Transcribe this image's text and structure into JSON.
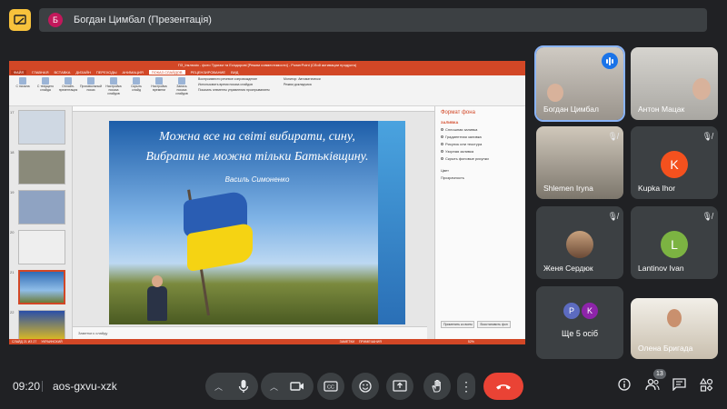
{
  "top": {
    "presenter_initial": "Б",
    "presenter_title": "Богдан Цимбал (Презентація)"
  },
  "share": {
    "ppt_title": "ПЗ_Інклюзія - фото Туризм та Есіздорові [Режим совместимости] - PowerPoint (Сбой активации продукта)",
    "tabs": [
      "ФАЙЛ",
      "ГЛАВНАЯ",
      "ВСТАВКА",
      "ДИЗАЙН",
      "ПЕРЕХОДЫ",
      "АНИМАЦИЯ",
      "ПОКАЗ СЛАЙДОВ",
      "РЕЦЕНЗИРОВАНИЕ",
      "ВИД"
    ],
    "active_tab_index": 6,
    "ribbon_buttons": [
      "С начала",
      "С текущего слайда",
      "Онлайн-презентация",
      "Произвольный показ",
      "Настройка показа слайдов",
      "Скрыть слайд",
      "Настройка времени",
      "Запись показа слайдов"
    ],
    "ribbon_checks": [
      "Воспроизвести речевое сопровождение",
      "Использовать время показа слайдов",
      "Показать элементы управления проигрыванием"
    ],
    "ribbon_monitor": [
      "Монитор: Автоматически",
      "Режим докладчика"
    ],
    "slide_numbers": [
      "17",
      "18",
      "19",
      "20",
      "21",
      "22"
    ],
    "selected_slide_index": 4,
    "slide_line1": "Можна все на світі вибирати, сину,",
    "slide_line2": "Вибрати не можна тільки Батьківщину.",
    "slide_author": "Василь Симоненко",
    "notes": "Заметки к слайду",
    "format_pane_title": "Формат фона",
    "format_pane_section": "ЗАЛИВКА",
    "format_pane_options": [
      "Сплошная заливка",
      "Градиентная заливка",
      "Рисунок или текстура",
      "Узорная заливка",
      "Скрыть фоновые рисунки",
      "Цвет",
      "Прозрачность"
    ],
    "format_pane_buttons": [
      "Применить ко всем",
      "Восстановить фон"
    ],
    "status": [
      "СЛАЙД 21 ИЗ 27",
      "УКРАИНСКИЙ",
      "ЗАМЕТКИ",
      "ПРИМЕЧАНИЯ",
      "52%"
    ]
  },
  "participants": [
    {
      "name": "Богдан Цимбал",
      "type": "video",
      "speaking": true
    },
    {
      "name": "Антон Мацак",
      "type": "video",
      "muted": false
    },
    {
      "name": "Shlemen Iryna",
      "type": "video",
      "muted": true
    },
    {
      "name": "Kupka Ihor",
      "type": "avatar",
      "initial": "K",
      "color": "#f4511e",
      "muted": true
    },
    {
      "name": "Женя Сердюк",
      "type": "photo",
      "muted": true
    },
    {
      "name": "Lantinov Ivan",
      "type": "avatar",
      "initial": "L",
      "color": "#7cb342",
      "muted": true
    },
    {
      "name": "Олена Бригада",
      "type": "video",
      "muted": false
    }
  ],
  "more": {
    "label": "Ще 5 осіб",
    "initials": [
      "P",
      "K"
    ],
    "colors": [
      "#5c6bc0",
      "#8e24aa"
    ]
  },
  "bottom": {
    "time": "09:20",
    "meeting_code": "aos-gxvu-xzk",
    "participants_count": "13",
    "mic_icon": "microphone-icon",
    "camera_icon": "camera-icon",
    "end_call_icon": "phone-hangup-icon"
  },
  "colors": {
    "background": "#202124",
    "surface": "#3c4043",
    "end_call": "#ea4335",
    "accent": "#8ab4f8"
  }
}
